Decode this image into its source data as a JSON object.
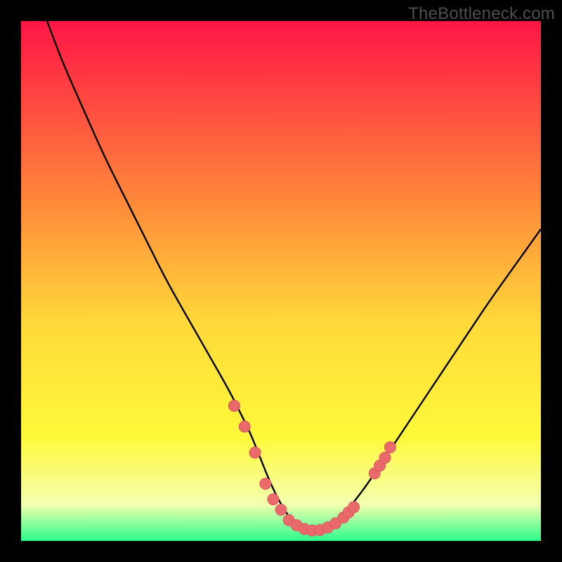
{
  "watermark": "TheBottleneck.com",
  "colors": {
    "black": "#000000",
    "curve": "#000000",
    "marker_fill": "#ea6a6c",
    "marker_stroke": "#d85b5d",
    "grad_top": "#ff1546",
    "grad_mid_upper": "#ff8a3a",
    "grad_mid": "#ffd93a",
    "grad_mid_lower": "#fff93a",
    "grad_bottom_glow": "#f3ffb0",
    "grad_bottom": "#2bfc8b"
  },
  "chart_data": {
    "type": "line",
    "title": "",
    "xlabel": "",
    "ylabel": "",
    "xlim": [
      0,
      100
    ],
    "ylim": [
      0,
      100
    ],
    "series": [
      {
        "name": "bottleneck-curve",
        "x": [
          5,
          8,
          12,
          16,
          20,
          24,
          28,
          32,
          36,
          40,
          42,
          44,
          46,
          48,
          50,
          52,
          54,
          56,
          58,
          60,
          62,
          66,
          70,
          74,
          78,
          82,
          86,
          90,
          95,
          100
        ],
        "y": [
          100,
          92,
          83,
          74,
          66,
          58,
          50,
          43,
          36,
          29,
          25,
          21,
          16,
          11,
          7,
          4,
          2.5,
          2,
          2.3,
          3,
          5,
          10,
          16,
          22,
          28,
          34,
          40,
          46,
          53,
          60
        ]
      }
    ],
    "markers": {
      "name": "highlight-points",
      "x": [
        41,
        43,
        45,
        47,
        48.5,
        50,
        51.5,
        53,
        54.5,
        56,
        57.5,
        59,
        60.5,
        62,
        63,
        64,
        68,
        69,
        70,
        71
      ],
      "y": [
        26,
        22,
        17,
        11,
        8,
        6,
        4,
        3,
        2.3,
        2,
        2.1,
        2.6,
        3.4,
        4.5,
        5.5,
        6.5,
        13,
        14.5,
        16,
        18
      ]
    }
  }
}
